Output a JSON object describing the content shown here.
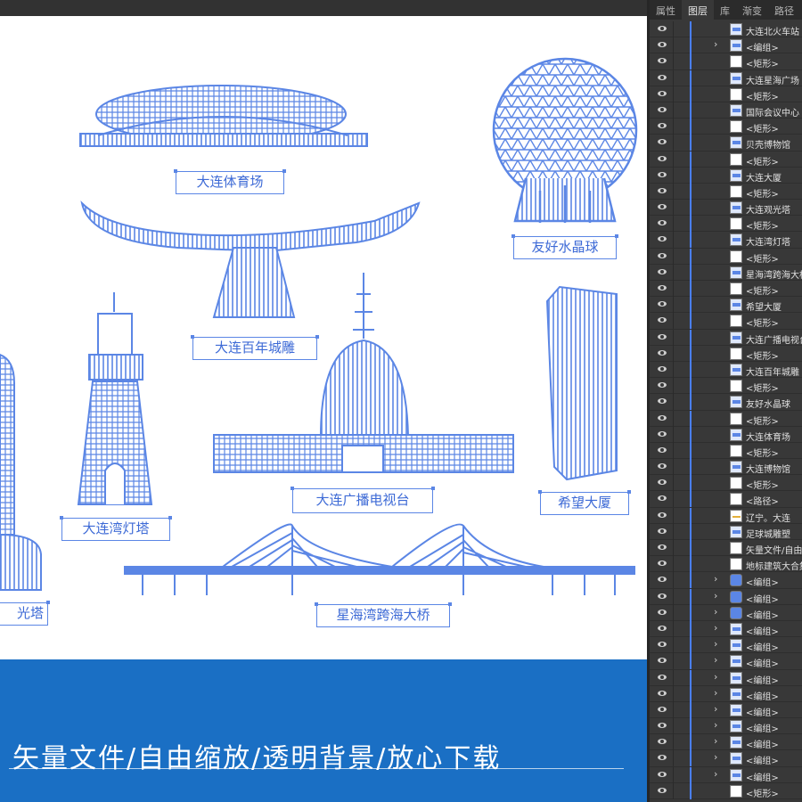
{
  "app": {
    "panel_tabs": [
      "属性",
      "图层",
      "库",
      "渐变",
      "路径"
    ],
    "active_tab": "图层"
  },
  "canvas": {
    "labels": {
      "stadium": "大连体育场",
      "crystal_ball": "友好水晶球",
      "sculpture": "大连百年城雕",
      "lighthouse": "大连湾灯塔",
      "tv_tower": "大连广播电视台",
      "hope_tower": "希望大厦",
      "tower_left": "光塔",
      "bridge": "星海湾跨海大桥"
    },
    "banner_text": "矢量文件/自由缩放/透明背景/放心下载"
  },
  "colors": {
    "accent": "#5b86e5",
    "banner": "#1a6fc4",
    "panel": "#383838"
  },
  "layers": [
    {
      "name": "大连北火车站",
      "thumb": "blue",
      "chevron": false
    },
    {
      "name": "<编组>",
      "thumb": "blue",
      "chevron": true
    },
    {
      "name": "<矩形>",
      "thumb": "white",
      "chevron": false
    },
    {
      "name": "大连星海广场",
      "thumb": "blue",
      "chevron": false
    },
    {
      "name": "<矩形>",
      "thumb": "white",
      "chevron": false
    },
    {
      "name": "国际会议中心",
      "thumb": "blue",
      "chevron": false
    },
    {
      "name": "<矩形>",
      "thumb": "white",
      "chevron": false
    },
    {
      "name": "贝壳博物馆",
      "thumb": "blue",
      "chevron": false
    },
    {
      "name": "<矩形>",
      "thumb": "white",
      "chevron": false
    },
    {
      "name": "大连大厦",
      "thumb": "blue",
      "chevron": false
    },
    {
      "name": "<矩形>",
      "thumb": "white",
      "chevron": false
    },
    {
      "name": "大连观光塔",
      "thumb": "blue",
      "chevron": false
    },
    {
      "name": "<矩形>",
      "thumb": "white",
      "chevron": false
    },
    {
      "name": "大连湾灯塔",
      "thumb": "blue",
      "chevron": false
    },
    {
      "name": "<矩形>",
      "thumb": "white",
      "chevron": false
    },
    {
      "name": "星海湾跨海大桥",
      "thumb": "blue",
      "chevron": false
    },
    {
      "name": "<矩形>",
      "thumb": "white",
      "chevron": false
    },
    {
      "name": "希望大厦",
      "thumb": "blue",
      "chevron": false
    },
    {
      "name": "<矩形>",
      "thumb": "white",
      "chevron": false
    },
    {
      "name": "大连广播电视台",
      "thumb": "blue",
      "chevron": false
    },
    {
      "name": "<矩形>",
      "thumb": "white",
      "chevron": false
    },
    {
      "name": "大连百年城雕",
      "thumb": "blue",
      "chevron": false
    },
    {
      "name": "<矩形>",
      "thumb": "white",
      "chevron": false
    },
    {
      "name": "友好水晶球",
      "thumb": "blue",
      "chevron": false
    },
    {
      "name": "<矩形>",
      "thumb": "white",
      "chevron": false
    },
    {
      "name": "大连体育场",
      "thumb": "blue",
      "chevron": false
    },
    {
      "name": "<矩形>",
      "thumb": "white",
      "chevron": false
    },
    {
      "name": "大连博物馆",
      "thumb": "blue",
      "chevron": false
    },
    {
      "name": "<矩形>",
      "thumb": "white",
      "chevron": false
    },
    {
      "name": "<路径>",
      "thumb": "white",
      "chevron": false
    },
    {
      "name": "辽宁。大连",
      "thumb": "yellow",
      "chevron": false
    },
    {
      "name": "足球城雕塑",
      "thumb": "blue",
      "chevron": false
    },
    {
      "name": "矢量文件/自由缩放",
      "thumb": "white",
      "chevron": false
    },
    {
      "name": "地标建筑大合集",
      "thumb": "white",
      "chevron": false
    },
    {
      "name": "<编组>",
      "thumb": "icon",
      "chevron": true
    },
    {
      "name": "<编组>",
      "thumb": "icon",
      "chevron": true
    },
    {
      "name": "<编组>",
      "thumb": "icon",
      "chevron": true
    },
    {
      "name": "<编组>",
      "thumb": "blue",
      "chevron": true
    },
    {
      "name": "<编组>",
      "thumb": "blue",
      "chevron": true
    },
    {
      "name": "<编组>",
      "thumb": "blue",
      "chevron": true
    },
    {
      "name": "<编组>",
      "thumb": "blue",
      "chevron": true
    },
    {
      "name": "<编组>",
      "thumb": "blue",
      "chevron": true
    },
    {
      "name": "<编组>",
      "thumb": "blue",
      "chevron": true
    },
    {
      "name": "<编组>",
      "thumb": "blue",
      "chevron": true
    },
    {
      "name": "<编组>",
      "thumb": "blue",
      "chevron": true
    },
    {
      "name": "<编组>",
      "thumb": "blue",
      "chevron": true
    },
    {
      "name": "<编组>",
      "thumb": "blue",
      "chevron": true
    },
    {
      "name": "<矩形>",
      "thumb": "white",
      "chevron": false
    }
  ]
}
